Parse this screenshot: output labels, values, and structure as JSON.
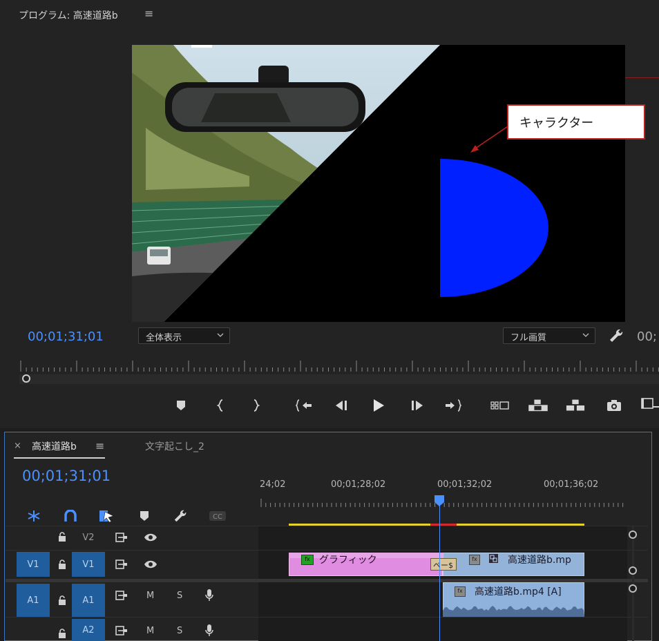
{
  "program_monitor": {
    "title": "プログラム: 高速道路b",
    "menu_icon": "hamburger-icon",
    "annotation_label": "キャラクター",
    "annotation_color": "#c0201d",
    "character_color": "#0020ff",
    "timecode": "00;01;31;01",
    "fit_option": "全体表示",
    "quality_option": "フル画質",
    "duration_timecode": "00;",
    "timecode_color": "#4a90ff",
    "transport_icons": [
      "add-marker-icon",
      "mark-in-icon",
      "mark-out-icon",
      "go-to-in-icon",
      "step-back-icon",
      "play-icon",
      "step-forward-icon",
      "go-to-out-icon",
      "comparison-view-icon",
      "lift-icon",
      "extract-icon",
      "export-frame-icon",
      "more-controls-icon"
    ]
  },
  "timeline": {
    "active_sequence_tab": "高速道路b",
    "second_tab": "文字起こし_2",
    "timecode": "00;01;31;01",
    "ruler_labels": [
      "24;02",
      "00;01;28;02",
      "00;01;32;02",
      "00;01;36;02"
    ],
    "tools": [
      "snap-icon",
      "linked-selection-icon",
      "insert-overwrite-icon",
      "add-marker-icon",
      "settings-wrench-icon",
      "captions-icon"
    ],
    "captions_tool_label": "CC",
    "tracks": {
      "v2": {
        "target": "V2"
      },
      "v1": {
        "source": "V1",
        "target": "V1"
      },
      "a1": {
        "source": "A1",
        "target": "A1",
        "mute": "M",
        "solo": "S"
      },
      "a2": {
        "target": "A2",
        "mute": "M",
        "solo": "S"
      }
    },
    "clips": {
      "graphic": {
        "name": "グラフィック",
        "fx": "fx",
        "color": "#e08ce0"
      },
      "transition": {
        "label": "ベー$"
      },
      "video": {
        "name": "高速道路b.mp",
        "fx": "fx"
      },
      "audio": {
        "name": "高速道路b.mp4 [A]",
        "fx": "fx"
      }
    },
    "work_area_color": "#e4d12d",
    "render_warning_color": "#d22a2a"
  }
}
